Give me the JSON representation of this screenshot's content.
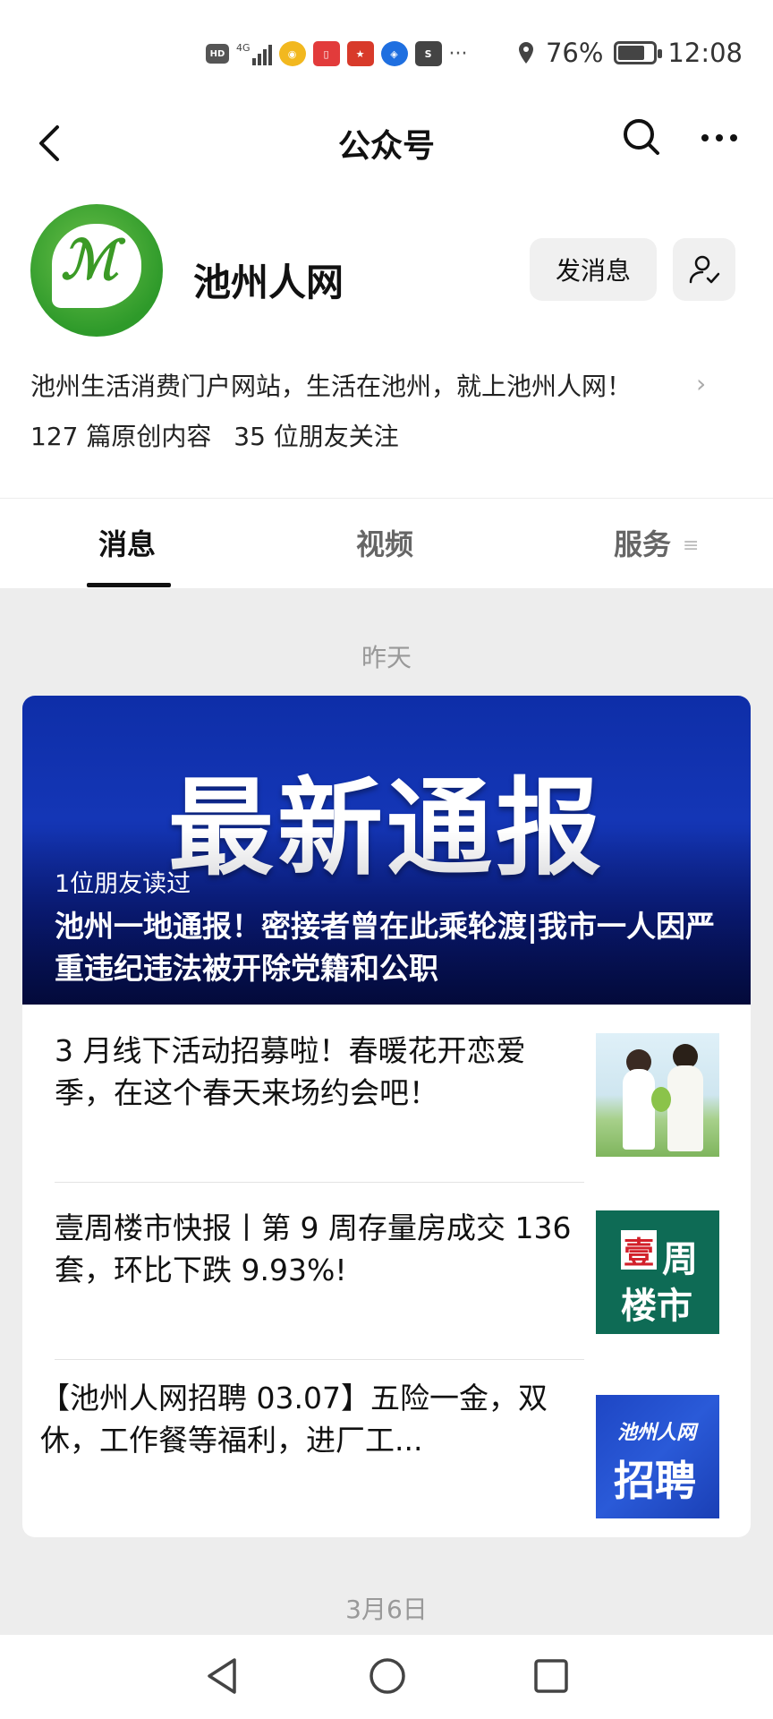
{
  "status_bar": {
    "battery_percent": "76%",
    "battery_level": 0.76,
    "time": "12:08",
    "network": "4G",
    "icons": [
      "hd-icon",
      "signal-icon",
      "weibo-icon",
      "book-icon",
      "gift-icon",
      "bulb-icon",
      "app-icon",
      "more-dots-icon",
      "location-icon",
      "battery-icon"
    ]
  },
  "nav": {
    "title": "公众号"
  },
  "profile": {
    "name": "池州人网",
    "send_message_label": "发消息",
    "description": "池州生活消费门户网站，生活在池州，就上池州人网！",
    "stat_articles": "127 篇原创内容",
    "stat_followers": "35 位朋友关注"
  },
  "tabs": [
    {
      "label": "消息",
      "active": true
    },
    {
      "label": "视频",
      "active": false
    },
    {
      "label": "服务",
      "active": false
    }
  ],
  "feed": {
    "date_1": "昨天",
    "hero": {
      "image_text": "最新通报",
      "readers": "1位朋友读过",
      "title": "池州一地通报！密接者曾在此乘轮渡|我市一人因严重违纪违法被开除党籍和公职"
    },
    "items": [
      {
        "title": "3 月线下活动招募啦！春暖花开恋爱季，在这个春天来场约会吧！"
      },
      {
        "title": "壹周楼市快报丨第 9 周存量房成交 136 套，环比下跌 9.93%!",
        "thumb_text_1": "壹",
        "thumb_text_2": "周",
        "thumb_text_3": "楼市"
      },
      {
        "title": "【池州人网招聘 03.07】五险一金，双休，工作餐等福利，进厂工...",
        "thumb_text_1": "池州人网",
        "thumb_text_2": "招聘"
      }
    ],
    "date_2": "3月6日"
  },
  "colors": {
    "accent_green": "#3b9a26",
    "hero_blue": "#1436b6",
    "thumb_green": "#0e6b55",
    "thumb_blue": "#1e46c4"
  }
}
